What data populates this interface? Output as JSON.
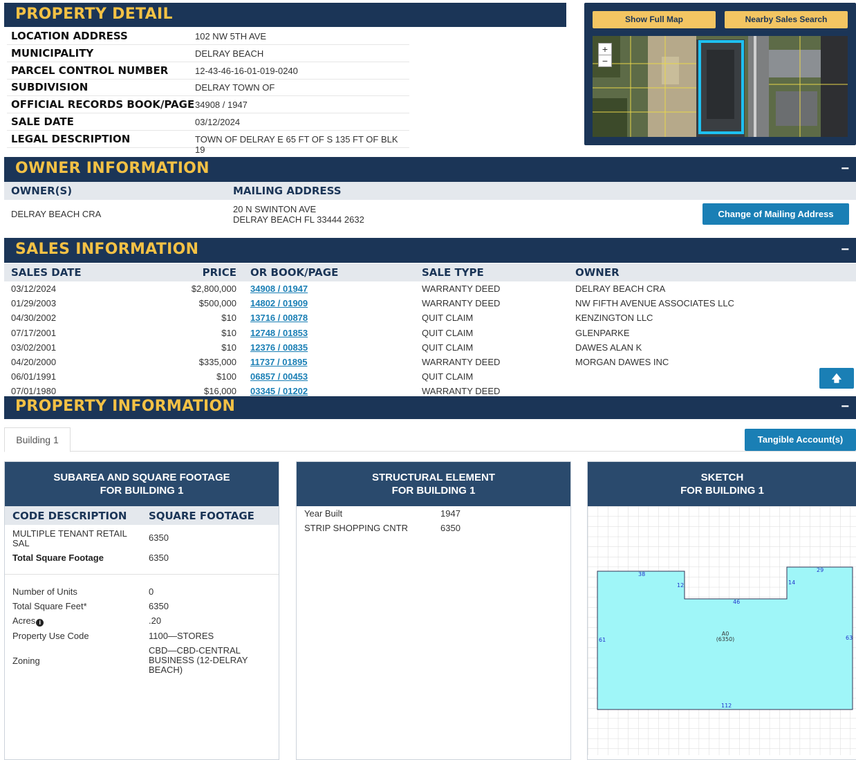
{
  "property_detail": {
    "title": "PROPERTY DETAIL",
    "rows": [
      {
        "label": "LOCATION ADDRESS",
        "value": "102 NW 5TH AVE"
      },
      {
        "label": "MUNICIPALITY",
        "value": "DELRAY BEACH"
      },
      {
        "label": "PARCEL CONTROL NUMBER",
        "value": "12-43-46-16-01-019-0240"
      },
      {
        "label": "SUBDIVISION",
        "value": "DELRAY TOWN OF"
      },
      {
        "label": "OFFICIAL RECORDS BOOK/PAGE",
        "value": "34908 / 1947"
      },
      {
        "label": "SALE DATE",
        "value": "03/12/2024"
      },
      {
        "label": "LEGAL DESCRIPTION",
        "value": "TOWN OF DELRAY E 65 FT OF S 135 FT OF BLK 19"
      }
    ]
  },
  "map": {
    "show_full_map": "Show Full Map",
    "nearby_sales": "Nearby Sales Search",
    "zoom_in": "+",
    "zoom_out": "−"
  },
  "owner": {
    "title": "OWNER INFORMATION",
    "collapse": "−",
    "col_owner": "OWNER(S)",
    "col_mailing": "MAILING ADDRESS",
    "owner_name": "DELRAY BEACH CRA",
    "mailing_line1": "20 N SWINTON AVE",
    "mailing_line2": "DELRAY BEACH FL 33444 2632",
    "change_button": "Change of Mailing Address"
  },
  "sales": {
    "title": "SALES INFORMATION",
    "collapse": "−",
    "headers": {
      "date": "SALES DATE",
      "price": "PRICE",
      "book": "OR BOOK/PAGE",
      "type": "SALE TYPE",
      "owner": "OWNER"
    },
    "rows": [
      {
        "date": "03/12/2024",
        "price": "$2,800,000",
        "book": "34908 / 01947",
        "type": "WARRANTY DEED",
        "owner": "DELRAY BEACH CRA"
      },
      {
        "date": "01/29/2003",
        "price": "$500,000",
        "book": "14802 / 01909",
        "type": "WARRANTY DEED",
        "owner": "NW FIFTH AVENUE ASSOCIATES LLC"
      },
      {
        "date": "04/30/2002",
        "price": "$10",
        "book": "13716 / 00878",
        "type": "QUIT CLAIM",
        "owner": "KENZINGTON LLC"
      },
      {
        "date": "07/17/2001",
        "price": "$10",
        "book": "12748 / 01853",
        "type": "QUIT CLAIM",
        "owner": "GLENPARKE"
      },
      {
        "date": "03/02/2001",
        "price": "$10",
        "book": "12376 / 00835",
        "type": "QUIT CLAIM",
        "owner": "DAWES ALAN K"
      },
      {
        "date": "04/20/2000",
        "price": "$335,000",
        "book": "11737 / 01895",
        "type": "WARRANTY DEED",
        "owner": "MORGAN DAWES INC"
      },
      {
        "date": "06/01/1991",
        "price": "$100",
        "book": "06857 / 00453",
        "type": "QUIT CLAIM",
        "owner": ""
      },
      {
        "date": "07/01/1980",
        "price": "$16,000",
        "book": "03345 / 01202",
        "type": "WARRANTY DEED",
        "owner": ""
      }
    ],
    "scroll_top_icon": "🡅"
  },
  "property_info": {
    "title": "PROPERTY INFORMATION",
    "collapse": "−",
    "tab_building": "Building 1",
    "tangible_button": "Tangible Account(s)",
    "subarea": {
      "title1": "SUBAREA AND SQUARE FOOTAGE",
      "title2": "FOR BUILDING 1",
      "col_code": "CODE DESCRIPTION",
      "col_sqft": "SQUARE FOOTAGE",
      "row1_code": "MULTIPLE TENANT RETAIL SAL",
      "row1_sqft": "6350",
      "total_label": "Total Square Footage",
      "total_value": "6350",
      "details": [
        {
          "label": "Number of Units",
          "value": "0"
        },
        {
          "label": "Total Square Feet*",
          "value": "6350"
        },
        {
          "label": "Acres",
          "value": ".20"
        },
        {
          "label": "Property Use Code",
          "value": "1100—STORES"
        },
        {
          "label": "Zoning",
          "value": "CBD—CBD-CENTRAL BUSINESS (12-DELRAY BEACH)"
        }
      ]
    },
    "structural": {
      "title1": "STRUCTURAL ELEMENT",
      "title2": "FOR BUILDING 1",
      "rows": [
        {
          "label": "Year Built",
          "value": "1947"
        },
        {
          "label": "STRIP SHOPPING CNTR",
          "value": "6350"
        }
      ]
    },
    "sketch": {
      "title1": "SKETCH",
      "title2": "FOR BUILDING 1",
      "dims": {
        "top_left": "38",
        "notch_left": "12",
        "notch_bottom": "46",
        "notch_right": "14",
        "top_right": "29",
        "left": "61",
        "right": "63",
        "bottom": "112"
      },
      "area_code": "A0",
      "area_sqft": "(6350)"
    }
  }
}
